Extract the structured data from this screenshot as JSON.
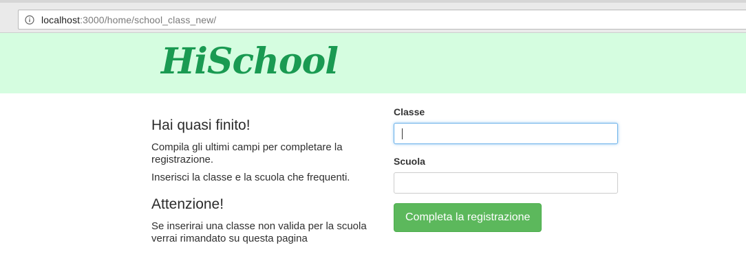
{
  "browser": {
    "url_host": "localhost",
    "url_path": ":3000/home/school_class_new/",
    "site_info_icon": "info-circle-icon"
  },
  "header": {
    "logo_text": "HiSchool",
    "background": "#d5fde0",
    "logo_color": "#1a9a52"
  },
  "intro": {
    "title": "Hai quasi finito!",
    "paragraph1": "Compila gli ultimi campi per completare la registrazione.",
    "paragraph2": "Inserisci la classe e la scuola che frequenti."
  },
  "warning": {
    "title": "Attenzione!",
    "paragraph": "Se inserirai una classe non valida per la scuola verrai rimandato su questa pagina"
  },
  "form": {
    "classe_label": "Classe",
    "classe_value": "",
    "scuola_label": "Scuola",
    "scuola_value": "",
    "submit_label": "Completa la registrazione",
    "submit_color": "#5cb85c"
  }
}
